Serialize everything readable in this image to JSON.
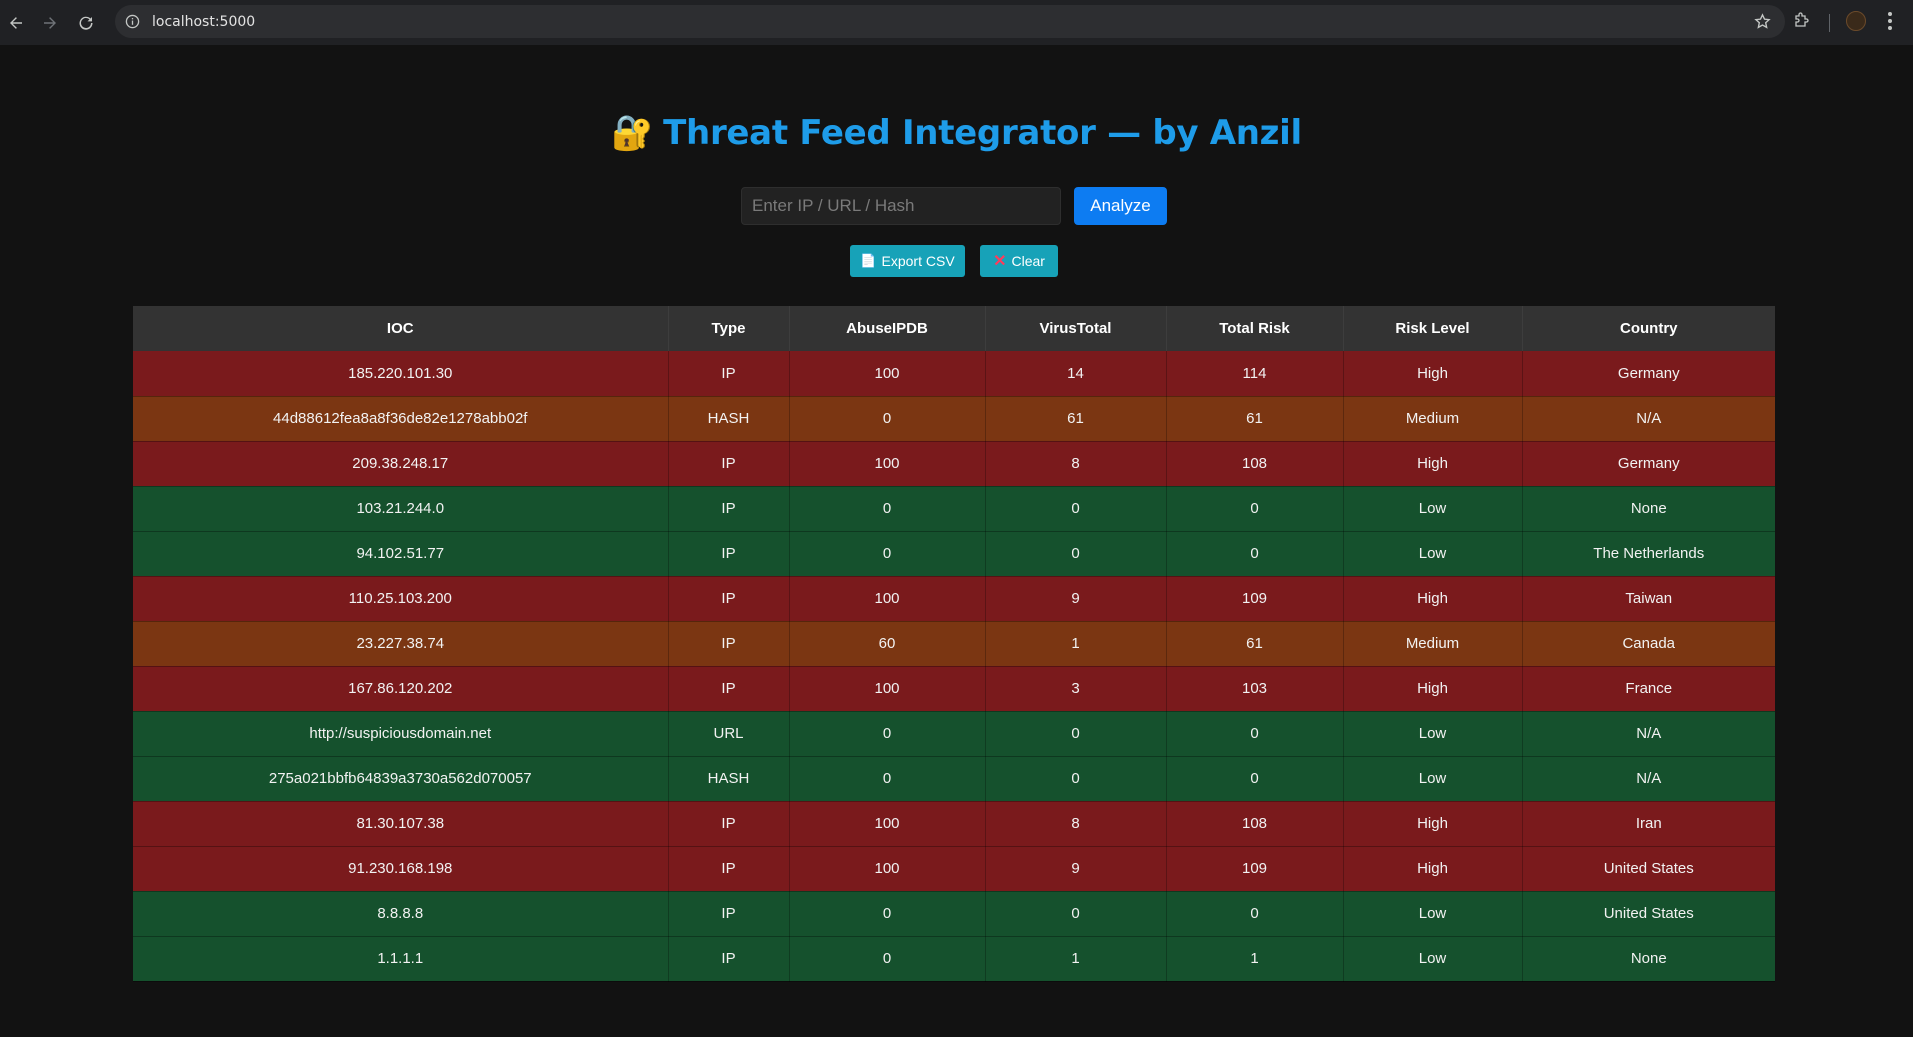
{
  "browser": {
    "url": "localhost:5000"
  },
  "page": {
    "title_icon": "🔐",
    "title": "Threat Feed Integrator — by Anzil",
    "search_placeholder": "Enter IP / URL / Hash",
    "search_value": "",
    "analyze_label": "Analyze",
    "export_label": "Export CSV",
    "export_icon": "📄",
    "clear_label": "Clear",
    "clear_icon": "✕"
  },
  "colors": {
    "title": "#1e9ce9",
    "high_row": "#7a1a1c",
    "medium_row": "#7b3612",
    "low_row": "#15512d",
    "analyze_button": "#0d7cf2",
    "action_button": "#17a2b8"
  },
  "table": {
    "headers": [
      "IOC",
      "Type",
      "AbuseIPDB",
      "VirusTotal",
      "Total Risk",
      "Risk Level",
      "Country"
    ],
    "rows": [
      [
        "185.220.101.30",
        "IP",
        "100",
        "14",
        "114",
        "High",
        "Germany"
      ],
      [
        "44d88612fea8a8f36de82e1278abb02f",
        "HASH",
        "0",
        "61",
        "61",
        "Medium",
        "N/A"
      ],
      [
        "209.38.248.17",
        "IP",
        "100",
        "8",
        "108",
        "High",
        "Germany"
      ],
      [
        "103.21.244.0",
        "IP",
        "0",
        "0",
        "0",
        "Low",
        "None"
      ],
      [
        "94.102.51.77",
        "IP",
        "0",
        "0",
        "0",
        "Low",
        "The Netherlands"
      ],
      [
        "110.25.103.200",
        "IP",
        "100",
        "9",
        "109",
        "High",
        "Taiwan"
      ],
      [
        "23.227.38.74",
        "IP",
        "60",
        "1",
        "61",
        "Medium",
        "Canada"
      ],
      [
        "167.86.120.202",
        "IP",
        "100",
        "3",
        "103",
        "High",
        "France"
      ],
      [
        "http://suspiciousdomain.net",
        "URL",
        "0",
        "0",
        "0",
        "Low",
        "N/A"
      ],
      [
        "275a021bbfb64839a3730a562d070057",
        "HASH",
        "0",
        "0",
        "0",
        "Low",
        "N/A"
      ],
      [
        "81.30.107.38",
        "IP",
        "100",
        "8",
        "108",
        "High",
        "Iran"
      ],
      [
        "91.230.168.198",
        "IP",
        "100",
        "9",
        "109",
        "High",
        "United States"
      ],
      [
        "8.8.8.8",
        "IP",
        "0",
        "0",
        "0",
        "Low",
        "United States"
      ],
      [
        "1.1.1.1",
        "IP",
        "0",
        "1",
        "1",
        "Low",
        "None"
      ]
    ]
  }
}
